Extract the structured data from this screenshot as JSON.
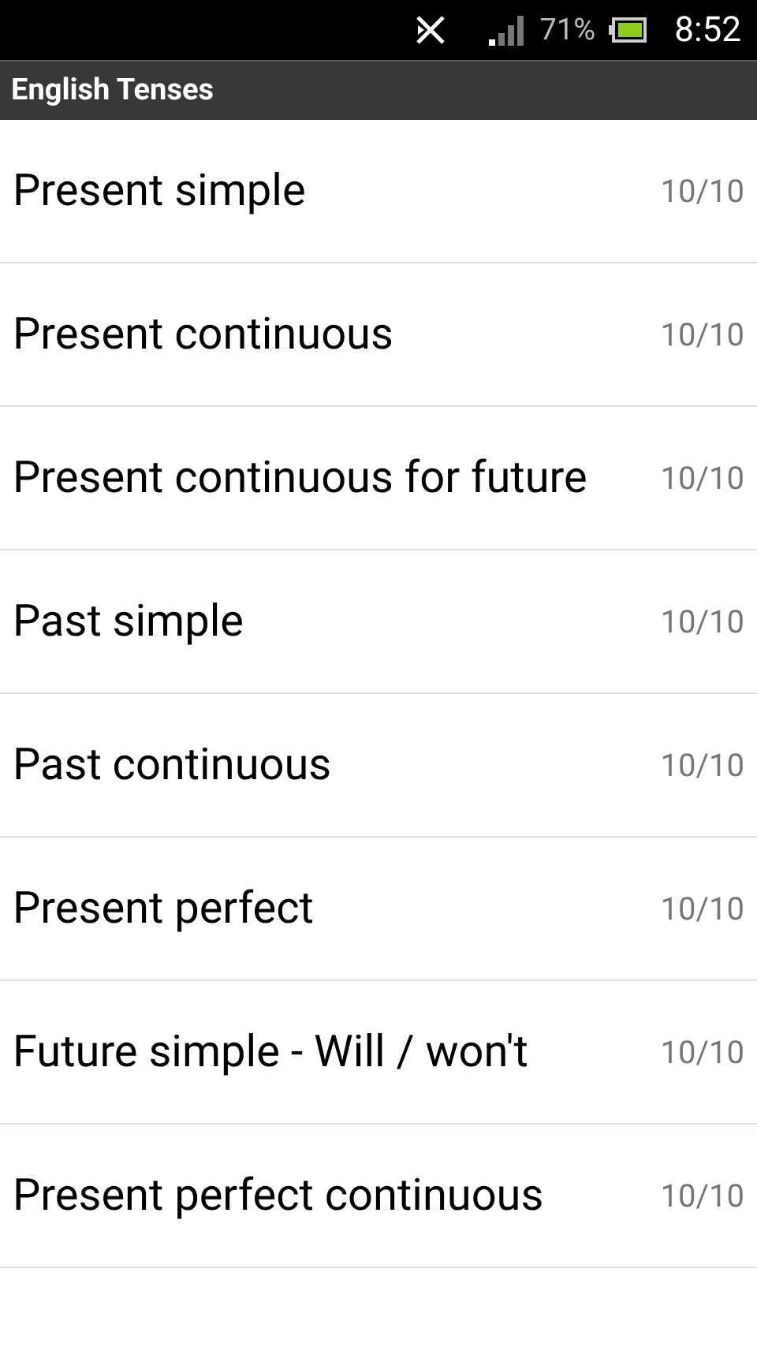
{
  "status_bar": {
    "battery_percent": "71%",
    "time": "8:52"
  },
  "title_bar": {
    "title": "English Tenses"
  },
  "lessons": [
    {
      "title": "Present simple",
      "score": "10/10"
    },
    {
      "title": "Present continuous",
      "score": "10/10"
    },
    {
      "title": "Present continuous for future",
      "score": "10/10"
    },
    {
      "title": "Past simple",
      "score": "10/10"
    },
    {
      "title": "Past continuous",
      "score": "10/10"
    },
    {
      "title": "Present perfect",
      "score": "10/10"
    },
    {
      "title": "Future simple - Will / won't",
      "score": "10/10"
    },
    {
      "title": "Present perfect continuous",
      "score": "10/10"
    }
  ]
}
